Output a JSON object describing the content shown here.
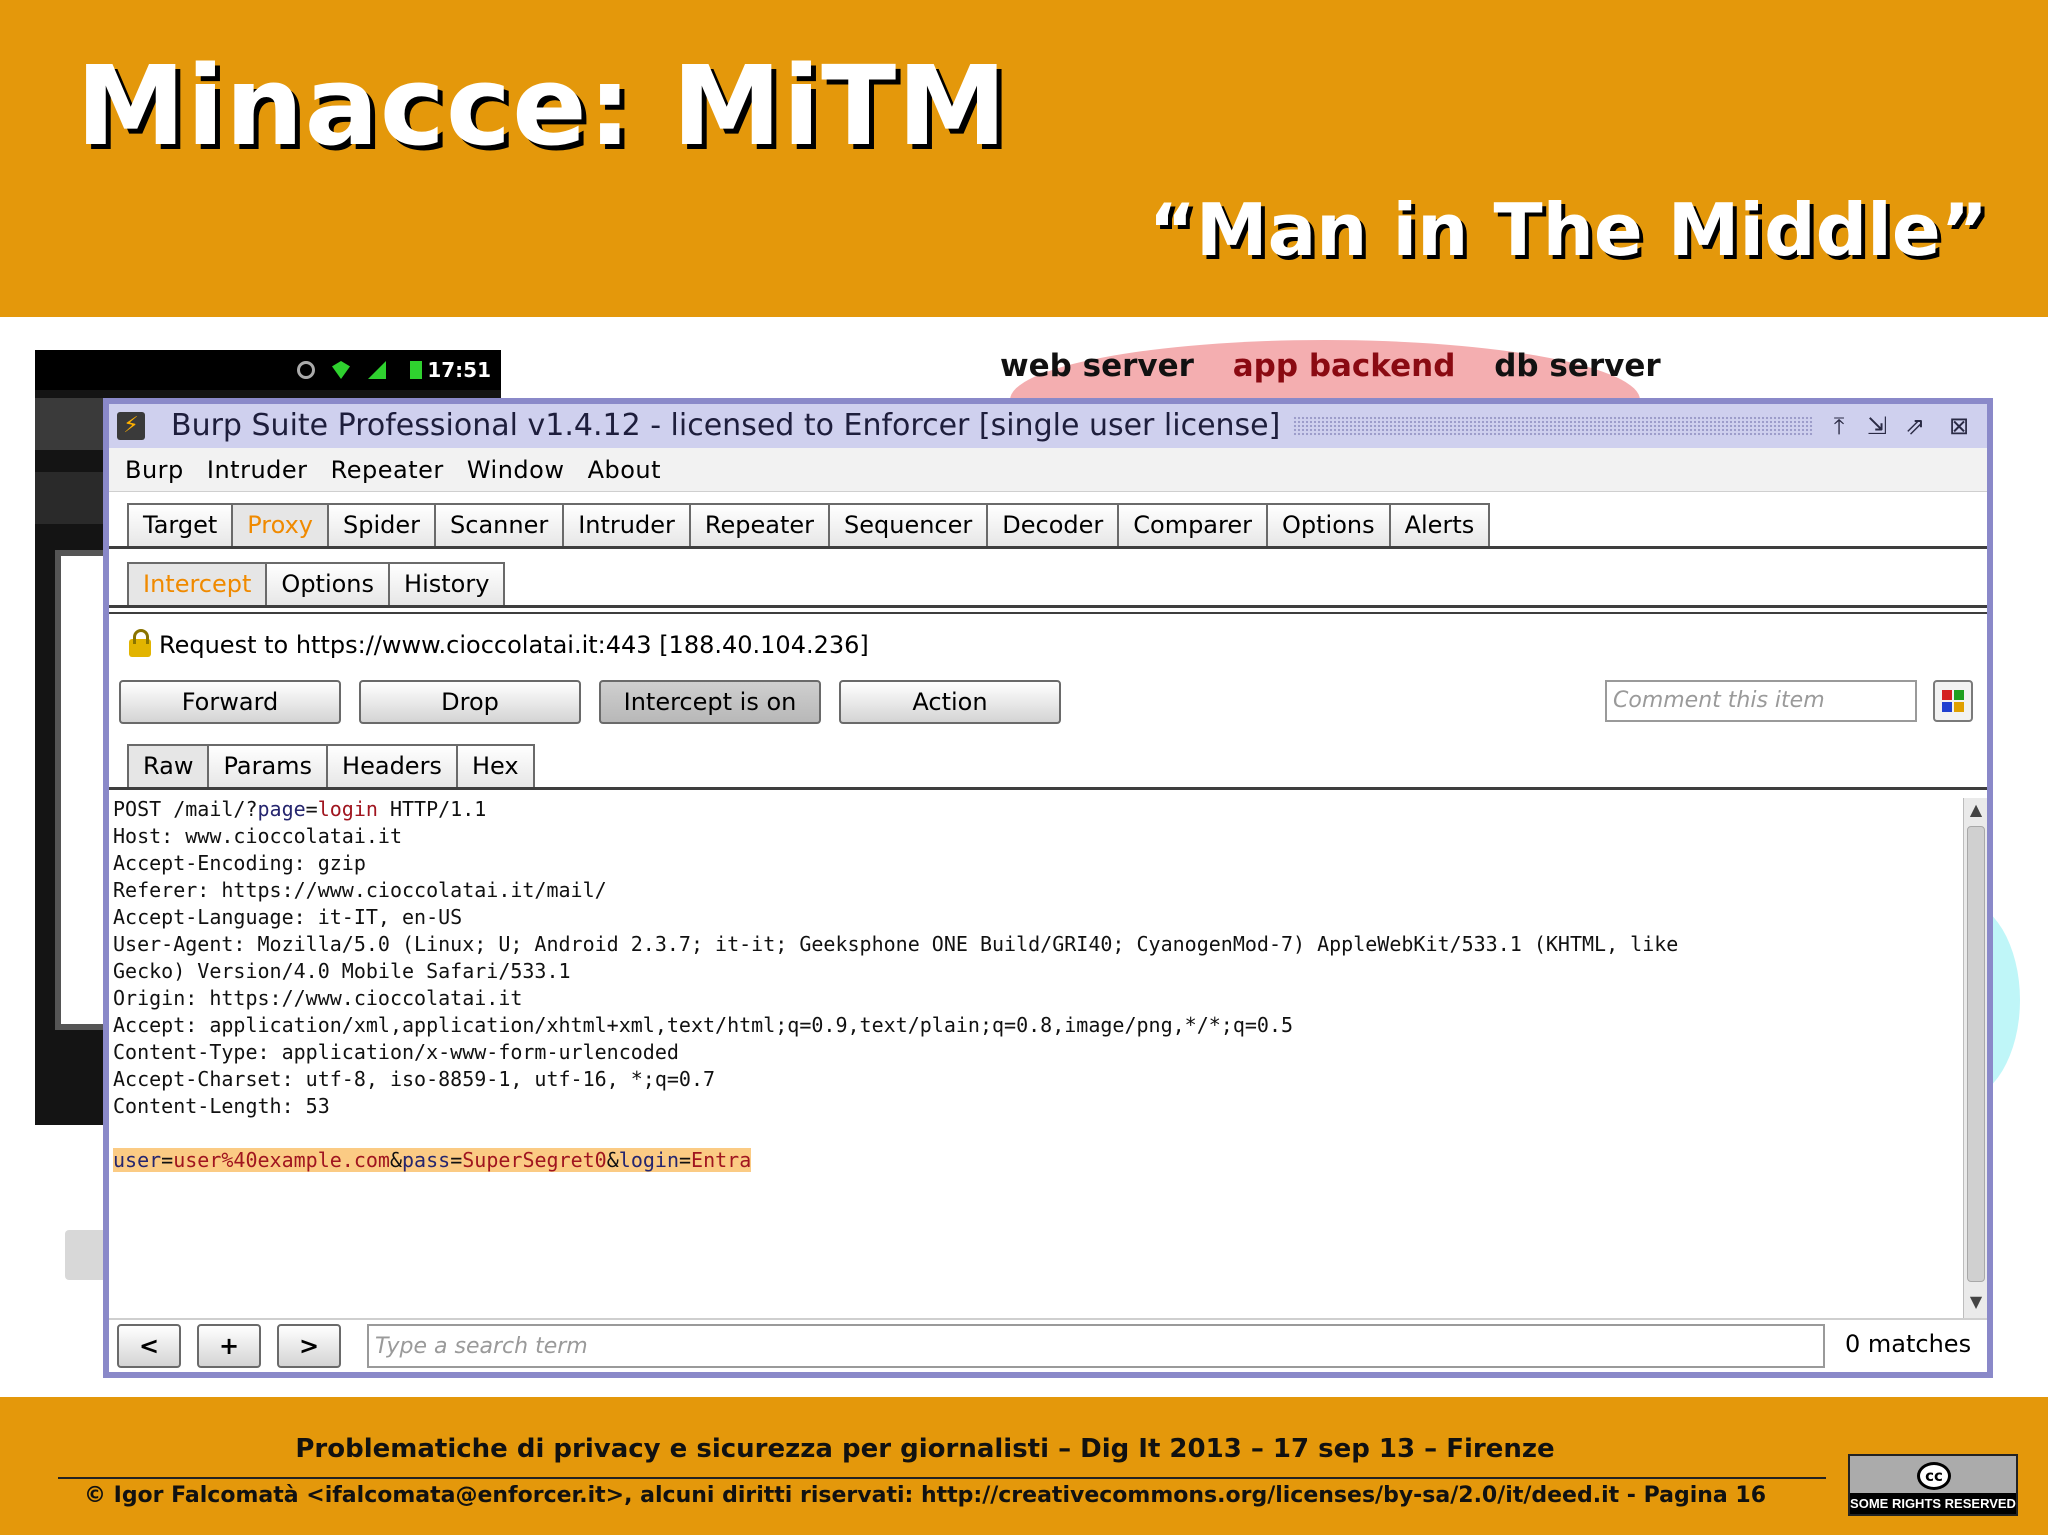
{
  "slide": {
    "title": "Minacce: MiTM",
    "subtitle": "“Man in The Middle”"
  },
  "diagram": {
    "labels": [
      "web server",
      "app backend",
      "db server"
    ]
  },
  "phone": {
    "time": "17:51"
  },
  "burp": {
    "window_title": "Burp Suite Professional v1.4.12 - licensed to Enforcer [single user license]",
    "menu": [
      "Burp",
      "Intruder",
      "Repeater",
      "Window",
      "About"
    ],
    "main_tabs": [
      "Target",
      "Proxy",
      "Spider",
      "Scanner",
      "Intruder",
      "Repeater",
      "Sequencer",
      "Decoder",
      "Comparer",
      "Options",
      "Alerts"
    ],
    "main_tab_selected": "Proxy",
    "proxy_tabs": [
      "Intercept",
      "Options",
      "History"
    ],
    "proxy_tab_selected": "Intercept",
    "request_to": "Request to https://www.cioccolatai.it:443  [188.40.104.236]",
    "buttons": {
      "forward": "Forward",
      "drop": "Drop",
      "intercept": "Intercept is on",
      "action": "Action"
    },
    "comment_placeholder": "Comment this item",
    "view_tabs": [
      "Raw",
      "Params",
      "Headers",
      "Hex"
    ],
    "view_tab_selected": "Raw",
    "request": {
      "line1_method": "POST /mail/?",
      "line1_param": "page",
      "line1_eq": "=",
      "line1_value": "login",
      "line1_proto": " HTTP/1.1",
      "headers": [
        "Host: www.cioccolatai.it",
        "Accept-Encoding: gzip",
        "Referer: https://www.cioccolatai.it/mail/",
        "Accept-Language: it-IT, en-US",
        "User-Agent: Mozilla/5.0 (Linux; U; Android 2.3.7; it-it; Geeksphone ONE Build/GRI40; CyanogenMod-7) AppleWebKit/533.1 (KHTML, like",
        "Gecko) Version/4.0 Mobile Safari/533.1",
        "Origin: https://www.cioccolatai.it",
        "Accept: application/xml,application/xhtml+xml,text/html;q=0.9,text/plain;q=0.8,image/png,*/*;q=0.5",
        "Content-Type: application/x-www-form-urlencoded",
        "Accept-Charset: utf-8, iso-8859-1, utf-16, *;q=0.7",
        "Content-Length: 53"
      ],
      "body": {
        "k1": "user",
        "v1": "user%40example.com",
        "amp1": "&",
        "k2": "pass",
        "v2": "SuperSegret0",
        "amp2": "&",
        "k3": "login",
        "v3": "Entra",
        "eq": "="
      }
    },
    "nav": {
      "prev": "<",
      "add": "+",
      "next": ">"
    },
    "search_placeholder": "Type a search term",
    "matches": "0 matches"
  },
  "footer": {
    "line1": "Problematiche di privacy e sicurezza per giornalisti – Dig It 2013 – 17 sep 13 – Firenze",
    "line2": "© Igor Falcomatà <ifalcomata@enforcer.it>, alcuni diritti riservati: http://creativecommons.org/licenses/by-sa/2.0/it/deed.it  - Pagina 16",
    "cc_logo": "cc",
    "cc_text": "SOME RIGHTS RESERVED"
  },
  "colors": {
    "slide_orange": "#e4980b",
    "burp_frame": "#8a89c9",
    "selected_tab": "#f08a00",
    "highlight": "#fbcb84"
  }
}
